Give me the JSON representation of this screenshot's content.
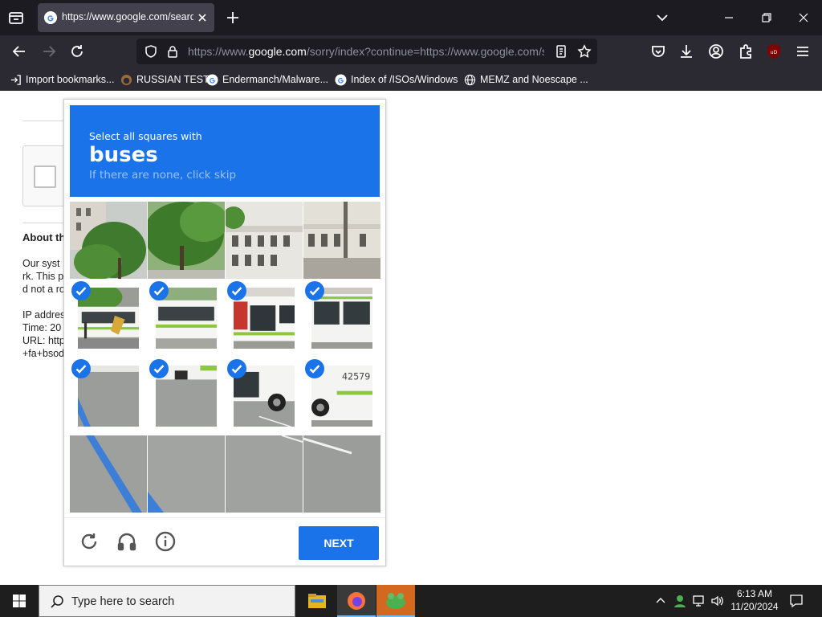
{
  "browser": {
    "tab": {
      "title": "https://www.google.com/search?"
    },
    "url": {
      "prefix": "https://www.",
      "host": "google.com",
      "path": "/sorry/index?continue=https://www.google.com/search"
    },
    "bookmarks": [
      {
        "label": "Import bookmarks..."
      },
      {
        "label": "RUSSIAN TEST"
      },
      {
        "label": "Endermanch/Malware..."
      },
      {
        "label": "Index of /ISOs/Windows"
      },
      {
        "label": "MEMZ and Noescape ..."
      }
    ]
  },
  "page": {
    "about_heading": "About th",
    "lines": [
      "Our syst",
      "rk. This p",
      "d not a ro",
      "IP addres",
      "Time: 20",
      "URL: http",
      "+fa+bsod"
    ]
  },
  "captcha": {
    "instruction": "Select all squares with",
    "target": "buses",
    "skip_hint": "If there are none, click skip",
    "next_label": "NEXT",
    "selected": [
      false,
      false,
      false,
      false,
      true,
      true,
      true,
      true,
      true,
      true,
      true,
      true,
      false,
      false,
      false,
      false
    ]
  },
  "taskbar": {
    "search_placeholder": "Type here to search",
    "time": "6:13 AM",
    "date": "11/20/2024"
  },
  "colors": {
    "captcha_blue": "#1a73e8",
    "browser_dark": "#1c1b22",
    "toolbar": "#2b2a33"
  }
}
